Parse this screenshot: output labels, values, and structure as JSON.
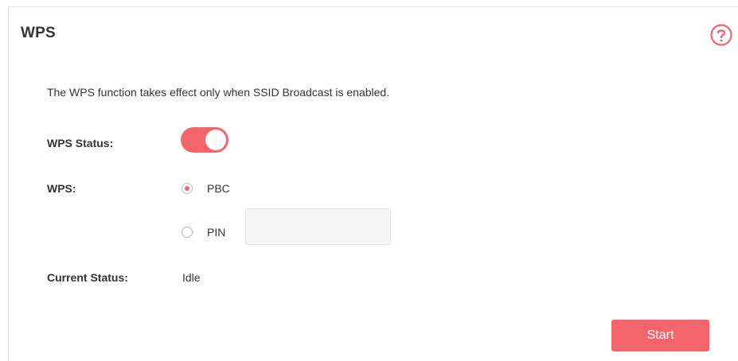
{
  "wps_panel": {
    "title": "WPS",
    "help_icon": "question-circle-icon",
    "description": "The WPS function takes effect only when SSID Broadcast is enabled.",
    "wps_status": {
      "label": "WPS Status:",
      "enabled": true
    },
    "wps_method": {
      "label": "WPS:",
      "options": [
        {
          "label": "PBC",
          "selected": true
        },
        {
          "label": "PIN",
          "selected": false
        }
      ],
      "pin_value": ""
    },
    "current_status": {
      "label": "Current Status:",
      "value": "Idle"
    },
    "start_label": "Start"
  },
  "colors": {
    "accent": "#f4656b",
    "text": "#333333",
    "input_bg": "#f5f5f5"
  }
}
